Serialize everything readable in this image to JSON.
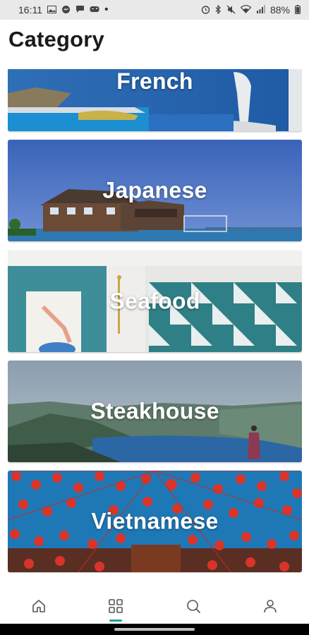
{
  "status_bar": {
    "time": "16:11",
    "battery": "88%",
    "left_icons": [
      "image-icon",
      "messenger-icon",
      "chat-icon",
      "gamepad-icon",
      "dot-icon"
    ],
    "right_icons": [
      "alarm-icon",
      "bluetooth-icon",
      "mute-icon",
      "wifi-icon",
      "signal-icon",
      "battery-icon"
    ]
  },
  "header": {
    "title": "Category"
  },
  "categories": [
    {
      "name": "French"
    },
    {
      "name": "Japanese"
    },
    {
      "name": "Seafood"
    },
    {
      "name": "Steakhouse"
    },
    {
      "name": "Vietnamese"
    }
  ],
  "bottom_nav": {
    "items": [
      "home-icon",
      "grid-icon",
      "search-icon",
      "user-icon"
    ],
    "active": "grid-icon"
  },
  "colors": {
    "accent": "#1aa39a",
    "title": "#1a1a1a",
    "status_bar_bg": "#e9e9e9"
  }
}
